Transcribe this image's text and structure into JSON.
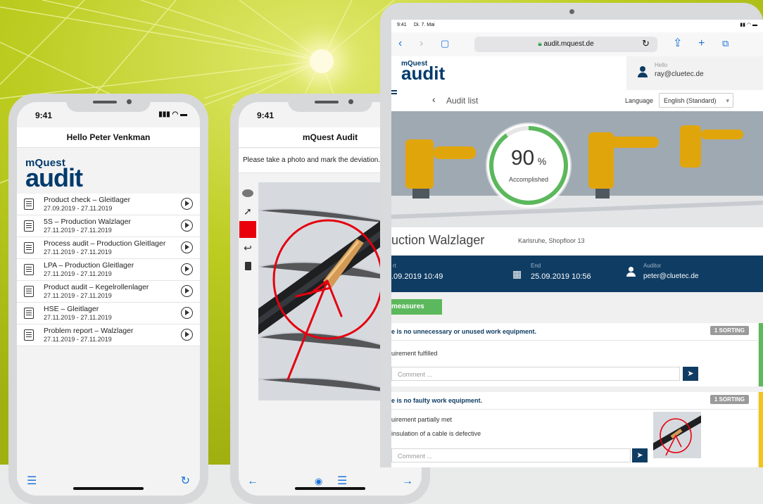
{
  "colors": {
    "accent_green": "#8dc63f",
    "navy": "#0f3c63",
    "lime_bg": "#b3c418",
    "link_blue": "#1a73d9",
    "ok_green": "#5cb85c",
    "warn_yellow": "#f0c419"
  },
  "brand": {
    "small": "mQuest",
    "big": "audit"
  },
  "phone1": {
    "time": "9:41",
    "title": "Hello Peter Venkman",
    "items": [
      {
        "name": "Product check – Gleitlager",
        "dates": "27.09.2019 - 27.11.2019"
      },
      {
        "name": "5S – Production Walzlager",
        "dates": "27.11.2019 - 27.11.2019"
      },
      {
        "name": "Process audit – Production Gleitlager",
        "dates": "27.11.2019 - 27.11.2019"
      },
      {
        "name": "LPA – Production Gleitlager",
        "dates": "27.11.2019 - 27.11.2019"
      },
      {
        "name": "Product audit – Kegelrollenlager",
        "dates": "27.11.2019 - 27.11.2019"
      },
      {
        "name": "HSE – Gleitlager",
        "dates": "27.11.2019 - 27.11.2019"
      },
      {
        "name": "Problem report – Walzlager",
        "dates": "27.11.2019 - 27.11.2019"
      }
    ],
    "bottom": {
      "left_icon": "list-icon",
      "right_icon": "refresh-icon"
    }
  },
  "phone2": {
    "time": "9:41",
    "title": "mQuest Audit",
    "instruction": "Please take a photo and mark the deviation.",
    "tools": [
      "lasso-icon",
      "arrow-icon",
      "color-swatch",
      "undo-icon",
      "trash-icon"
    ]
  },
  "tablet": {
    "status": {
      "time": "9:41",
      "date": "Di. 7. Mai"
    },
    "url": "audit.mquest.de",
    "user": {
      "greeting": "Hello",
      "email": "ray@cluetec.de"
    },
    "nav": {
      "back": "Audit list",
      "language_label": "Language",
      "language_value": "English (Standard)"
    },
    "progress": {
      "value": "90",
      "unit": "%",
      "label": "Accomplished",
      "fraction": 0.9
    },
    "audit_title": "uction Walzlager",
    "audit_location": "Karlsruhe, Shopfloor 13",
    "start": {
      "label": "rt",
      "value": ".09.2019 10:49"
    },
    "end": {
      "label": "End",
      "value": "25.09.2019 10:56"
    },
    "auditor": {
      "label": "Auditor",
      "value": "peter@cluetec.de"
    },
    "measures_btn": " measures",
    "questions": [
      {
        "text": "e is no unnecessary or unused work equipment.",
        "badge": "1 SORTING",
        "answer": "uirement fulfilled",
        "comment_placeholder": "Comment ..."
      },
      {
        "text": "e is no faulty work equipment.",
        "badge": "1 SORTING",
        "answer": "uirement partially met",
        "note": "insulation of a cable is defective",
        "comment_placeholder": "Comment ..."
      }
    ]
  }
}
